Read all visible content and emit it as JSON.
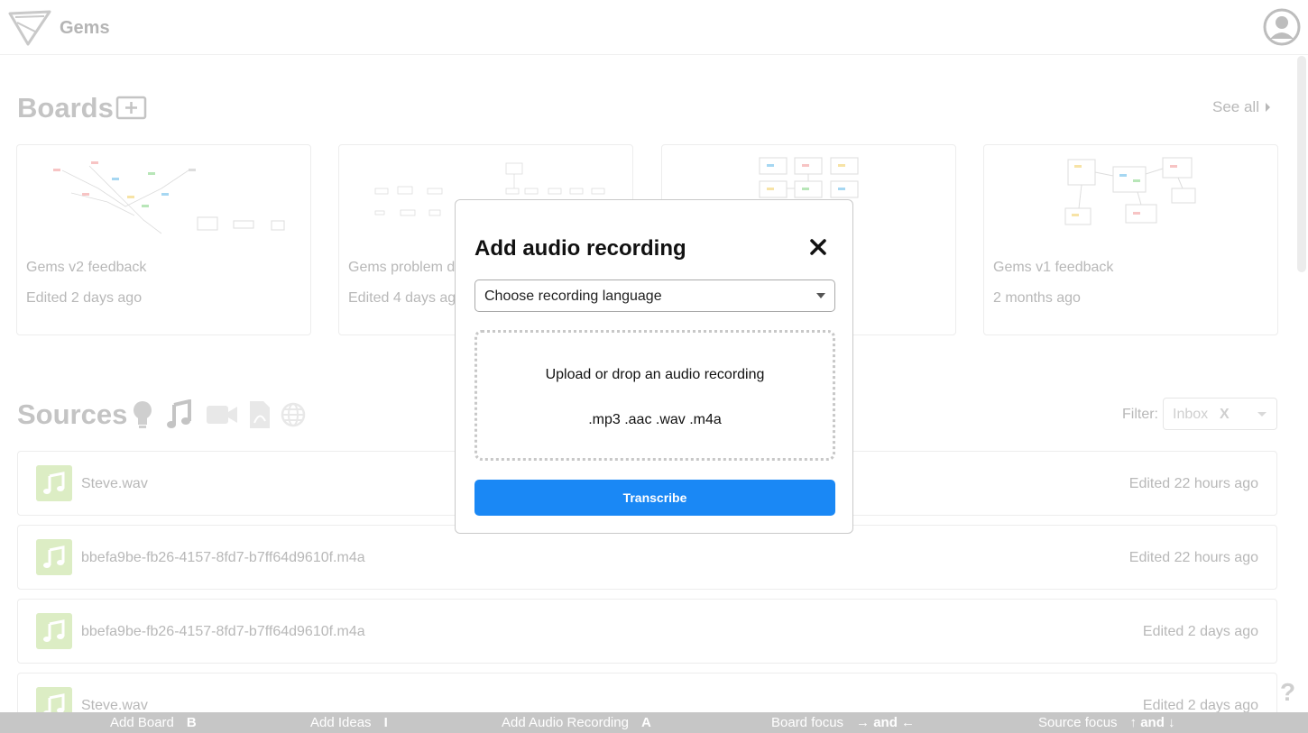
{
  "header": {
    "app_name": "Gems",
    "logo_icon": "gems-logo-icon",
    "profile_icon": "user-circle-icon"
  },
  "boards": {
    "title": "Boards",
    "add_icon": "plus-square-icon",
    "see_all": "See all",
    "cards": [
      {
        "name": "Gems v2 feedback",
        "date": "Edited 2 days ago"
      },
      {
        "name": "Gems problem d",
        "date": "Edited 4 days ag"
      },
      {
        "name": "",
        "date": ""
      },
      {
        "name": "Gems v1 feedback",
        "date": "2 months ago"
      }
    ]
  },
  "sources": {
    "title": "Sources",
    "type_icons": [
      "lightbulb-icon",
      "music-note-icon",
      "video-camera-icon",
      "pdf-file-icon",
      "globe-icon"
    ],
    "filter_label": "Filter:",
    "filter_value": "Inbox",
    "filter_clear": "X",
    "rows": [
      {
        "name": "Steve.wav",
        "date": "Edited 22 hours ago",
        "icon": "music-note-icon"
      },
      {
        "name": "bbefa9be-fb26-4157-8fd7-b7ff64d9610f.m4a",
        "date": "Edited 22 hours ago",
        "icon": "music-note-icon"
      },
      {
        "name": "bbefa9be-fb26-4157-8fd7-b7ff64d9610f.m4a",
        "date": "Edited 2 days ago",
        "icon": "music-note-icon"
      },
      {
        "name": "Steve.wav",
        "date": "Edited 2 days ago",
        "icon": "music-note-icon"
      }
    ]
  },
  "help": "?",
  "shortcuts": [
    {
      "label": "Add Board",
      "key": "B"
    },
    {
      "label": "Add Ideas",
      "key": "I"
    },
    {
      "label": "Add Audio Recording",
      "key": "A"
    },
    {
      "label": "Board focus",
      "key": "→ and ←"
    },
    {
      "label": "Source focus",
      "key": "↑ and ↓"
    }
  ],
  "modal": {
    "title": "Add audio recording",
    "close_icon": "close-icon",
    "language_placeholder": "Choose recording language",
    "dropzone_title": "Upload or drop an audio recording",
    "dropzone_formats": ".mp3 .aac .wav .m4a",
    "transcribe_label": "Transcribe"
  },
  "colors": {
    "accent": "#1a88f5",
    "audio_icon_bg": "#dcedc4",
    "muted_text": "#b8b8b8",
    "shortcut_bar": "#c6c6c6"
  }
}
